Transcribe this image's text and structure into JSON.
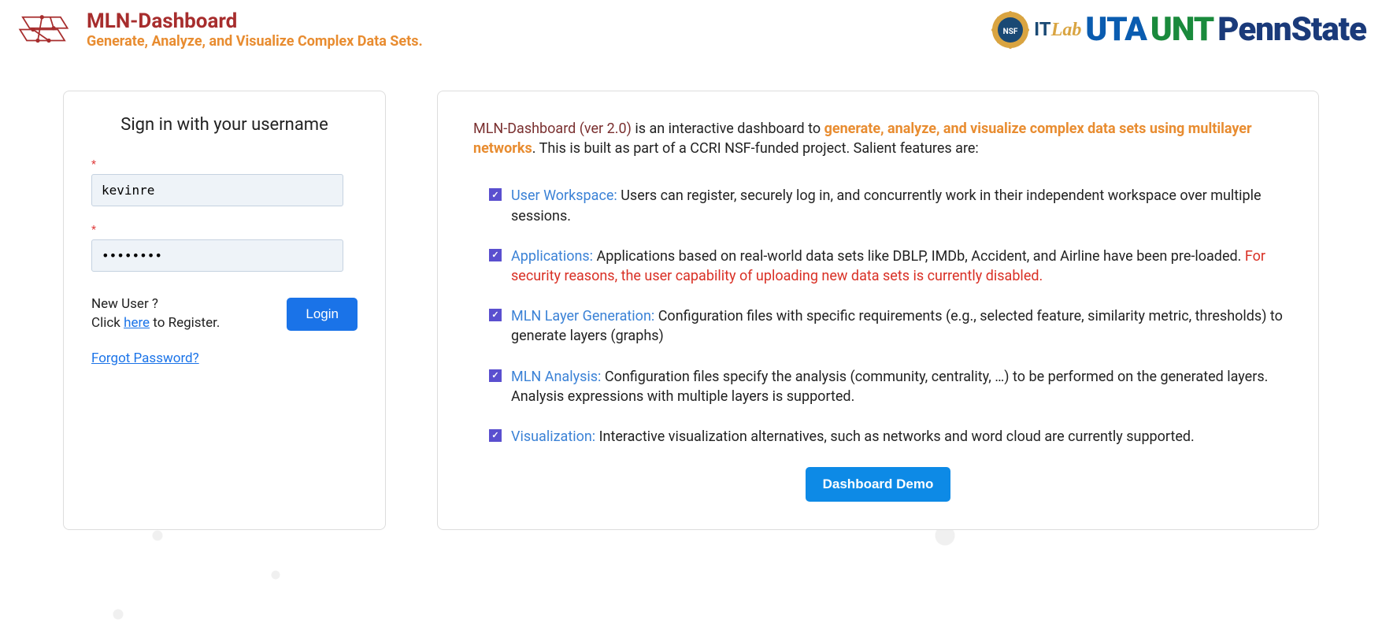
{
  "header": {
    "title": "MLN-Dashboard",
    "subtitle": "Generate, Analyze, and Visualize Complex Data Sets.",
    "logos": {
      "itlab_it": "IT",
      "itlab_lab": "Lab",
      "uta": "UTA",
      "unt": "UNT",
      "pennstate": "PennState"
    }
  },
  "login": {
    "title": "Sign in with your username",
    "username_value": "kevinre",
    "password_value": "••••••••",
    "new_user_text": "New User ?",
    "click_text": "Click ",
    "here_text": "here",
    "register_text": " to Register.",
    "login_btn": "Login",
    "forgot_link": "Forgot Password?"
  },
  "info": {
    "intro_app": "MLN-Dashboard (ver 2.0)",
    "intro_is": " is an interactive dashboard to ",
    "intro_highlight": "generate, analyze, and visualize complex data sets using multilayer networks",
    "intro_rest": ". This is built as part of a CCRI NSF-funded project. Salient features are:",
    "features": [
      {
        "label": "User Workspace:",
        "desc": " Users can register, securely log in, and concurrently work in their independent workspace over multiple sessions.",
        "warning": ""
      },
      {
        "label": "Applications:",
        "desc": " Applications based on real-world data sets like DBLP, IMDb, Accident, and Airline have been pre-loaded. ",
        "warning": "For security reasons, the user capability of uploading new data sets is currently disabled."
      },
      {
        "label": "MLN Layer Generation:",
        "desc": " Configuration files with specific requirements (e.g., selected feature, similarity metric, thresholds) to generate layers (graphs)",
        "warning": ""
      },
      {
        "label": "MLN Analysis:",
        "desc": " Configuration files specify the analysis (community, centrality, …) to be performed on the generated layers. Analysis expressions with multiple layers is supported.",
        "warning": ""
      },
      {
        "label": "Visualization:",
        "desc": " Interactive visualization alternatives, such as networks and word cloud are currently supported.",
        "warning": ""
      }
    ],
    "demo_btn": "Dashboard Demo"
  }
}
